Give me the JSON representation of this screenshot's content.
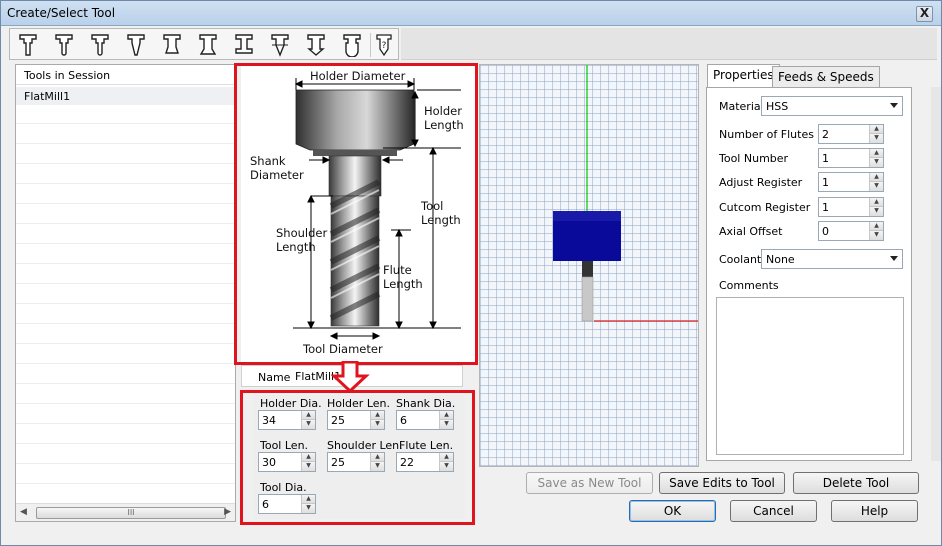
{
  "window": {
    "title": "Create/Select Tool",
    "close_label": "X"
  },
  "toolbar": {
    "icons": [
      "flat-mill-icon",
      "bull-mill-icon",
      "ball-mill-icon",
      "tapered-mill-icon",
      "chamfer-mill-icon",
      "dovetail-mill-icon",
      "slot-mill-icon",
      "engraving-tool-icon",
      "drill-icon",
      "counterbore-icon",
      "custom-tool-icon"
    ],
    "help_glyph": "?"
  },
  "tools_list": {
    "header": "Tools in Session",
    "items": [
      "FlatMill1"
    ],
    "scroll_thumb_label": "III",
    "scroll_left": "◀",
    "scroll_right": "▶"
  },
  "diagram": {
    "holder_diameter": "Holder Diameter",
    "holder_length": "Holder\nLength",
    "shank_diameter": "Shank\nDiameter",
    "tool_length": "Tool\nLength",
    "shoulder_length": "Shoulder\nLength",
    "flute_length": "Flute\nLength",
    "tool_diameter": "Tool Diameter"
  },
  "name": {
    "label": "Name",
    "value": "FlatMill1"
  },
  "params": {
    "holder_dia": {
      "label": "Holder Dia.",
      "value": "34"
    },
    "holder_len": {
      "label": "Holder Len.",
      "value": "25"
    },
    "shank_dia": {
      "label": "Shank Dia.",
      "value": "6"
    },
    "tool_len": {
      "label": "Tool Len.",
      "value": "30"
    },
    "shoulder_len": {
      "label": "Shoulder Len.",
      "value": "25"
    },
    "flute_len": {
      "label": "Flute Len.",
      "value": "22"
    },
    "tool_dia": {
      "label": "Tool Dia.",
      "value": "6"
    }
  },
  "properties": {
    "tabs": [
      "Properties",
      "Feeds & Speeds"
    ],
    "material": {
      "label": "Material",
      "value": "HSS"
    },
    "number_of_flutes": {
      "label": "Number of Flutes",
      "value": "2"
    },
    "tool_number": {
      "label": "Tool Number",
      "value": "1"
    },
    "adjust_register": {
      "label": "Adjust Register",
      "value": "1"
    },
    "cutcom_register": {
      "label": "Cutcom Register",
      "value": "1"
    },
    "axial_offset": {
      "label": "Axial Offset",
      "value": "0"
    },
    "coolant": {
      "label": "Coolant",
      "value": "None"
    },
    "comments": {
      "label": "Comments",
      "value": ""
    }
  },
  "buttons": {
    "save_as_new": "Save as New Tool",
    "save_edits": "Save Edits to Tool",
    "delete": "Delete Tool",
    "ok": "OK",
    "cancel": "Cancel",
    "help": "Help"
  },
  "colors": {
    "highlight_red": "#e0141e",
    "holder_blue": "#0a0a9a",
    "axis_green": "#00cc00",
    "axis_red": "#e02020"
  }
}
